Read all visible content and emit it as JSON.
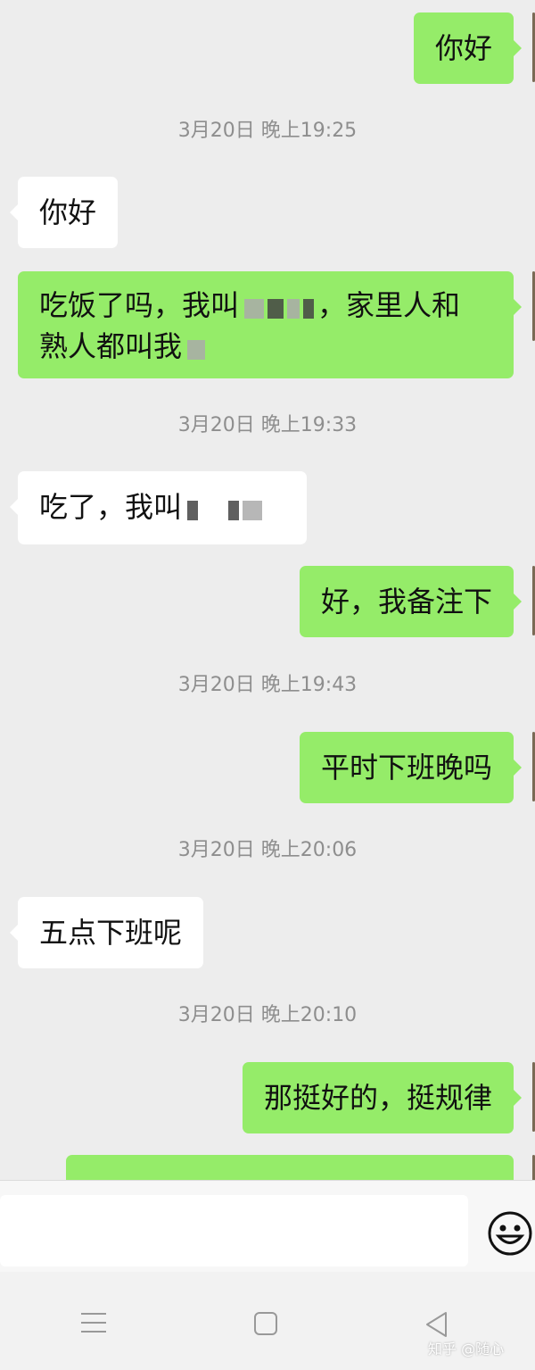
{
  "messages": [
    {
      "dir": "out",
      "text": "你好"
    },
    {
      "dir": "time",
      "text": "3月20日 晚上19:25"
    },
    {
      "dir": "in",
      "text": "你好"
    },
    {
      "dir": "out",
      "line1": "吃饭了吗，我叫",
      "line1b": "，家里人和",
      "line2": "熟人都叫我"
    },
    {
      "dir": "time",
      "text": "3月20日 晚上19:33"
    },
    {
      "dir": "in",
      "text": "吃了，我叫"
    },
    {
      "dir": "out",
      "text": "好，我备注下"
    },
    {
      "dir": "time",
      "text": "3月20日 晚上19:43"
    },
    {
      "dir": "out",
      "text": "平时下班晚吗"
    },
    {
      "dir": "time",
      "text": "3月20日 晚上20:06"
    },
    {
      "dir": "in",
      "text": "五点下班呢"
    },
    {
      "dir": "time",
      "text": "3月20日 晚上20:10"
    },
    {
      "dir": "out",
      "text": "那挺好的，挺规律"
    }
  ],
  "input": {
    "placeholder": ""
  },
  "nav": {
    "menu_icon": "menu-icon",
    "home_icon": "home-square-icon",
    "back_icon": "back-triangle-icon"
  },
  "watermark": "知乎 @随心",
  "colors": {
    "outgoing": "#95ec69",
    "incoming": "#ffffff",
    "background": "#ededed"
  }
}
